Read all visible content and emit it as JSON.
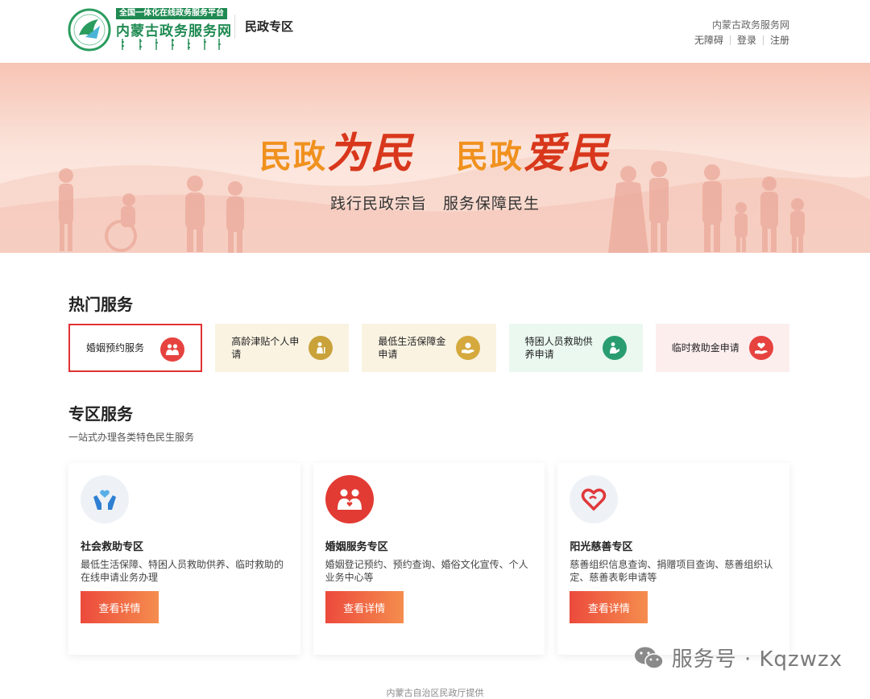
{
  "header": {
    "logo_tag": "全国一体化在线政务服务平台",
    "logo_name": "内蒙古政务服务网",
    "zone_title": "民政专区",
    "site_name": "内蒙古政务服务网",
    "links": [
      "无障碍",
      "登录",
      "注册"
    ]
  },
  "banner": {
    "slogan_part1": "民政",
    "slogan_part2": "为民",
    "slogan_part3": "民政",
    "slogan_part4": "爱民",
    "subtitle": "践行民政宗旨　服务保障民生"
  },
  "hot": {
    "title": "热门服务",
    "items": [
      {
        "label": "婚姻预约服务",
        "icon": "couple-icon",
        "bg": "#ffffff",
        "icon_color": "#e64340"
      },
      {
        "label": "高龄津贴个人申请",
        "icon": "elder-icon",
        "bg": "#faf3e2",
        "icon_color": "#c9a23a"
      },
      {
        "label": "最低生活保障金申请",
        "icon": "hand-coin-icon",
        "bg": "#faf3e2",
        "icon_color": "#d5a93e"
      },
      {
        "label": "特困人员救助供养申请",
        "icon": "care-icon",
        "bg": "#eaf8f0",
        "icon_color": "#2a9d70"
      },
      {
        "label": "临时救助金申请",
        "icon": "heart-hand-icon",
        "bg": "#fdeeee",
        "icon_color": "#e64340"
      }
    ]
  },
  "zone": {
    "title": "专区服务",
    "subtitle": "一站式办理各类特色民生服务",
    "cards": [
      {
        "name": "社会救助专区",
        "desc": "最低生活保障、特困人员救助供养、临时救助的在线申请业务办理",
        "button": "查看详情",
        "icon": "hands-heart-icon"
      },
      {
        "name": "婚姻服务专区",
        "desc": "婚姻登记预约、预约查询、婚俗文化宣传、个人业务中心等",
        "button": "查看详情",
        "icon": "couple-icon"
      },
      {
        "name": "阳光慈善专区",
        "desc": "慈善组织信息查询、捐赠项目查询、慈善组织认定、慈善表彰申请等",
        "button": "查看详情",
        "icon": "heart-icon"
      }
    ]
  },
  "watermark": "服务号 · Kqzwzx",
  "footer": "内蒙古自治区民政厅提供"
}
